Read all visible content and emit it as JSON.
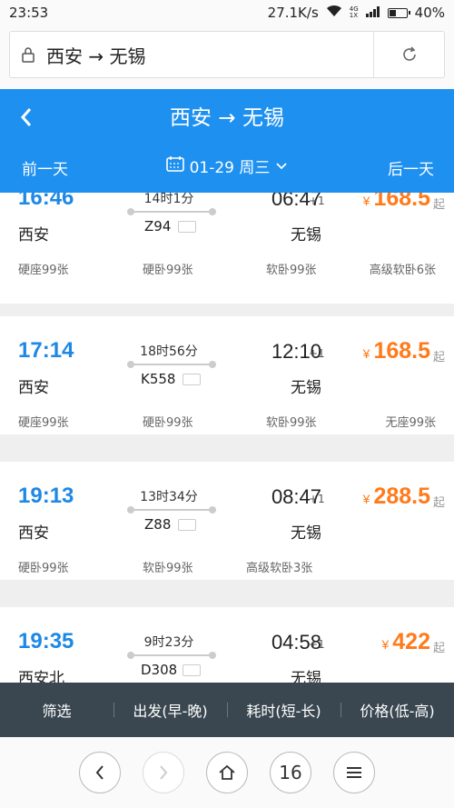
{
  "status_bar": {
    "time": "23:53",
    "speed": "27.1K/s",
    "net_type_top": "4G",
    "net_type_bottom": "1X",
    "battery": "40%"
  },
  "browser": {
    "url_text": "西安 → 无锡",
    "tab_count": "16"
  },
  "header": {
    "title": "西安 → 无锡",
    "prev_day": "前一天",
    "next_day": "后一天",
    "date": "01-29 周三"
  },
  "trains": [
    {
      "dep_time": "16:46",
      "dep_station": "西安",
      "duration": "14时1分",
      "train_no": "Z94",
      "arr_time": "06:47",
      "plus_day": "+1",
      "arr_station": "无锡",
      "price": "168.5",
      "seats": [
        "硬座99张",
        "硬卧99张",
        "软卧99张",
        "高级软卧6张"
      ]
    },
    {
      "dep_time": "17:14",
      "dep_station": "西安",
      "duration": "18时56分",
      "train_no": "K558",
      "arr_time": "12:10",
      "plus_day": "+1",
      "arr_station": "无锡",
      "price": "168.5",
      "seats": [
        "硬座99张",
        "硬卧99张",
        "软卧99张",
        "无座99张"
      ]
    },
    {
      "dep_time": "19:13",
      "dep_station": "西安",
      "duration": "13时34分",
      "train_no": "Z88",
      "arr_time": "08:47",
      "plus_day": "+1",
      "arr_station": "无锡",
      "price": "288.5",
      "seats": [
        "硬卧99张",
        "软卧99张",
        "高级软卧3张"
      ]
    },
    {
      "dep_time": "19:35",
      "dep_station": "西安北",
      "duration": "9时23分",
      "train_no": "D308",
      "arr_time": "04:58",
      "plus_day": "+1",
      "arr_station": "无锡",
      "price": "422",
      "seats": []
    }
  ],
  "common": {
    "yen": "¥",
    "qi": "起"
  },
  "filter_bar": {
    "filter": "筛选",
    "depart": "出发(早-晚)",
    "duration": "耗时(短-长)",
    "price": "价格(低-高)"
  },
  "colors": {
    "header_blue": "#1e90f0",
    "time_blue": "#1e88e5",
    "price_orange": "#ff7a1a",
    "filter_bar": "#3a4750"
  }
}
